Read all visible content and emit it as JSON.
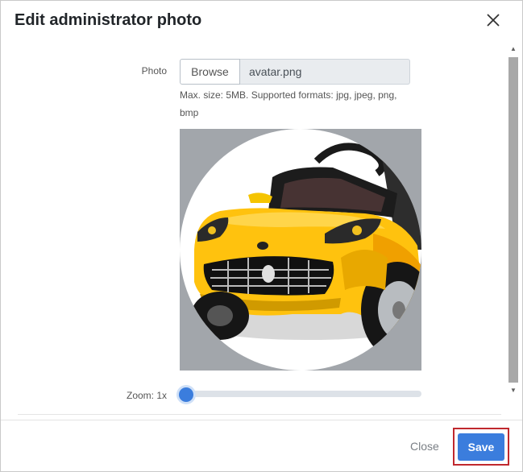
{
  "modal": {
    "title": "Edit administrator photo"
  },
  "photo_field": {
    "label": "Photo",
    "browse_label": "Browse",
    "file_name": "avatar.png",
    "help_text": "Max. size: 5MB. Supported formats: jpg, jpeg, png, bmp"
  },
  "zoom": {
    "label": "Zoom: 1x",
    "level_fraction": 0
  },
  "footer": {
    "close_label": "Close",
    "save_label": "Save"
  },
  "colors": {
    "primary": "#3b7ddd",
    "highlight_frame": "#c0282e",
    "crop_background": "#a2a6ab"
  },
  "icons": {
    "close": "close-icon",
    "scroll_up": "scroll-up-arrow-icon",
    "scroll_down": "scroll-down-arrow-icon"
  }
}
